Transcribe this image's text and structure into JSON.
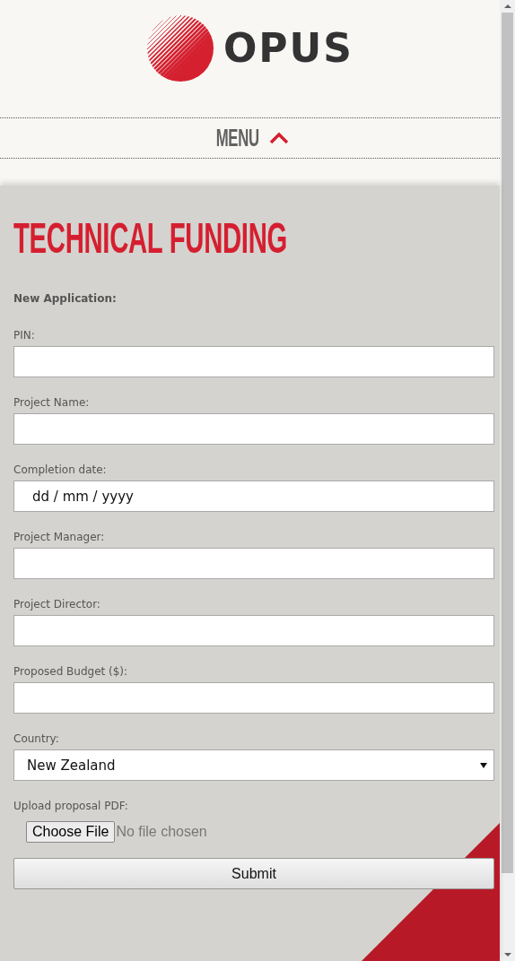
{
  "header": {
    "logo_text": "OPUS",
    "menu": {
      "label": "MENU",
      "expanded": true
    }
  },
  "form": {
    "title": "TECHNICAL FUNDING",
    "subtitle": "New Application:",
    "fields": [
      {
        "kind": "text",
        "label": "PIN:"
      },
      {
        "kind": "text",
        "label": "Project Name:"
      },
      {
        "kind": "date",
        "label": "Completion date:",
        "placeholder": "dd / mm / yyyy"
      },
      {
        "kind": "text",
        "label": "Project Manager:"
      },
      {
        "kind": "text",
        "label": "Project Director:"
      },
      {
        "kind": "text",
        "label": "Proposed Budget ($):"
      },
      {
        "kind": "select",
        "label": "Country:",
        "value": "New Zealand"
      },
      {
        "kind": "file",
        "label": "Upload proposal PDF:",
        "button": "Choose File",
        "status": "No file chosen"
      }
    ],
    "submit": "Submit"
  }
}
